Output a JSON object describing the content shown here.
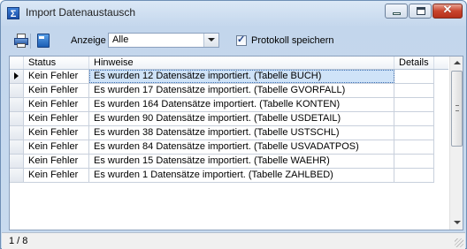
{
  "window": {
    "title": "Import Datenaustausch",
    "app_icon": "sigma-icon",
    "app_icon_glyph": "Σ",
    "controls": {
      "minimize": "minimize-icon",
      "maximize": "maximize-icon",
      "close_glyph": "✕"
    }
  },
  "toolbar": {
    "print_icon": "print-icon",
    "export_icon": "export-icon",
    "anzeige_label": "Anzeige",
    "anzeige_value": "Alle",
    "protokoll_label": "Protokoll speichern",
    "protokoll_checked": true,
    "check_glyph": "✓"
  },
  "grid": {
    "columns": [
      "Status",
      "Hinweise",
      "Details"
    ],
    "rows": [
      {
        "status": "Kein Fehler",
        "hint": "Es wurden 12 Datensätze importiert. (Tabelle BUCH)",
        "details": ""
      },
      {
        "status": "Kein Fehler",
        "hint": "Es wurden 17 Datensätze importiert. (Tabelle GVORFALL)",
        "details": ""
      },
      {
        "status": "Kein Fehler",
        "hint": "Es wurden 164 Datensätze importiert. (Tabelle KONTEN)",
        "details": ""
      },
      {
        "status": "Kein Fehler",
        "hint": "Es wurden 90 Datensätze importiert. (Tabelle USDETAIL)",
        "details": ""
      },
      {
        "status": "Kein Fehler",
        "hint": "Es wurden 38 Datensätze importiert. (Tabelle USTSCHL)",
        "details": ""
      },
      {
        "status": "Kein Fehler",
        "hint": "Es wurden 84 Datensätze importiert. (Tabelle USVADATPOS)",
        "details": ""
      },
      {
        "status": "Kein Fehler",
        "hint": "Es wurden 15 Datensätze importiert. (Tabelle WAEHR)",
        "details": ""
      },
      {
        "status": "Kein Fehler",
        "hint": "Es wurden 1 Datensätze importiert. (Tabelle ZAHLBED)",
        "details": ""
      }
    ],
    "selected_row": 0
  },
  "status_bar": {
    "record": "1 / 8"
  },
  "colors": {
    "selection": "#cfe3f8",
    "title_bg": "#c3d6ec",
    "close_button": "#c9442d"
  }
}
